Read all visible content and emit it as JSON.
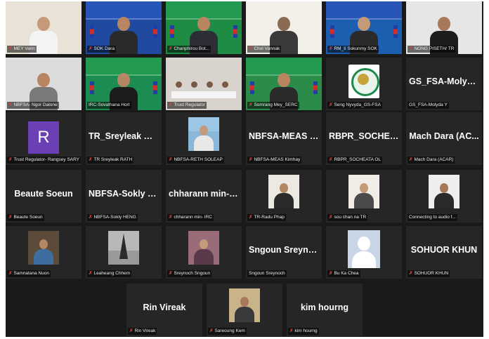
{
  "participants": [
    {
      "label": "MEY Vann",
      "kind": "video",
      "muted": true
    },
    {
      "label": "SOK Dara",
      "kind": "video",
      "muted": true
    },
    {
      "label": "Chanphirou Bot...",
      "kind": "video",
      "muted": true
    },
    {
      "label": "Chol Vannak",
      "kind": "video",
      "muted": true
    },
    {
      "label": "RM_Ii Sokunmy SOK",
      "kind": "video",
      "muted": true
    },
    {
      "label": "NONG PISETH/ TR",
      "kind": "video",
      "muted": true
    },
    {
      "label": "NBFSA- Ngor Dalone",
      "kind": "video",
      "muted": true
    },
    {
      "label": "IRC-Sovathana Hort",
      "kind": "video",
      "muted": false
    },
    {
      "label": "Trust Regulator",
      "kind": "video",
      "muted": true
    },
    {
      "label": "Somrang Mey_SERC",
      "kind": "video",
      "muted": true
    },
    {
      "label": "Seng Nyvyda_GS-FSA",
      "kind": "logo",
      "muted": true
    },
    {
      "label": "GS_FSA-Molyda Y",
      "kind": "name",
      "big": "GS_FSA-Molyda Y",
      "muted": false
    },
    {
      "label": "Trust Regulator- Rangsey SARY",
      "kind": "avatar",
      "initial": "R",
      "muted": true
    },
    {
      "label": "TR Sreyleak RATH",
      "kind": "name",
      "big": "TR_Sreyleak RATH",
      "muted": true
    },
    {
      "label": "NBFSA-RETH SOLEAP",
      "kind": "video",
      "muted": true
    },
    {
      "label": "NBFSA-MEAS Kimhay",
      "kind": "name",
      "big": "NBFSA-MEAS Ki...",
      "muted": true
    },
    {
      "label": "RBPR_SOCHEATA OL",
      "kind": "name",
      "big": "RBPR_SOCHEAT...",
      "muted": true
    },
    {
      "label": "Mach Dara (ACAR)",
      "kind": "name",
      "big": "Mach Dara (AC...",
      "muted": true
    },
    {
      "label": "Beaute Soeun",
      "kind": "name",
      "big": "Beaute Soeun",
      "muted": true
    },
    {
      "label": "NBFSA-Sokly HENG",
      "kind": "name",
      "big": "NBFSA-Sokly H...",
      "muted": true
    },
    {
      "label": "chharann min- IRC",
      "kind": "name",
      "big": "chharann min- I...",
      "muted": true
    },
    {
      "label": "TR-Radu Phap",
      "kind": "video",
      "muted": true
    },
    {
      "label": "sou chan na TR",
      "kind": "video",
      "muted": true
    },
    {
      "label": "Connecting to audio f...",
      "kind": "video",
      "muted": false
    },
    {
      "label": "Samnatana Nuon",
      "kind": "video",
      "muted": true
    },
    {
      "label": "Leaheang Chhem",
      "kind": "video",
      "muted": true
    },
    {
      "label": "Sreynoch Sngoun",
      "kind": "video",
      "muted": true
    },
    {
      "label": "Sngoun Sreynoch",
      "kind": "name",
      "big": "Sngoun Sreynoch",
      "muted": false
    },
    {
      "label": "Bu Ka Chea",
      "kind": "silhouette",
      "muted": true
    },
    {
      "label": "SOHUOR KHUN",
      "kind": "name",
      "big": "SOHUOR KHUN",
      "muted": true
    },
    {
      "label": "Rin Vireak",
      "kind": "name",
      "big": "Rin Vireak",
      "muted": true
    },
    {
      "label": "Sareoung Kem",
      "kind": "video",
      "muted": true
    },
    {
      "label": "kim hourng",
      "kind": "name",
      "big": "kim hourng",
      "muted": true
    }
  ],
  "colors": {
    "active_border": "#c9d640",
    "muted_mic": "#e23b3b",
    "tile_bg": "#262626",
    "stage_bg": "#1a1a1a"
  }
}
